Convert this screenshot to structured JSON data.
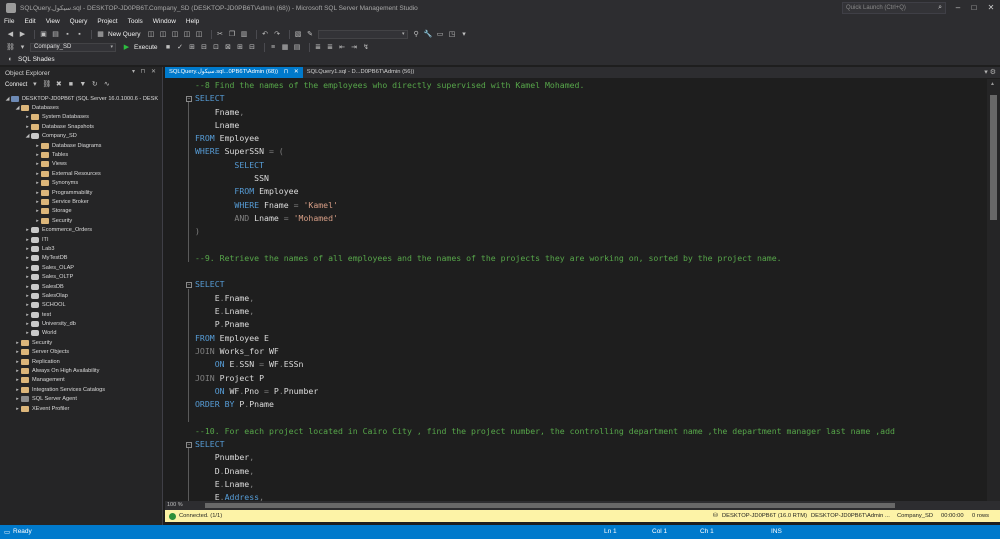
{
  "window": {
    "title": "SQLQuery.سيكول.sql - DESKTOP-JD0PB6T.Company_SD (DESKTOP-JD0PB6T\\Admin (68)) - Microsoft SQL Server Management Studio",
    "quick_launch_placeholder": "Quick Launch (Ctrl+Q)"
  },
  "menu": [
    "File",
    "Edit",
    "View",
    "Query",
    "Project",
    "Tools",
    "Window",
    "Help"
  ],
  "toolbar": {
    "new_query_label": "New Query",
    "database_selected": "Company_SD",
    "execute_label": "Execute",
    "sql_shades_label": "SQL Shades"
  },
  "object_explorer": {
    "title": "Object Explorer",
    "connect_label": "Connect",
    "nodes": [
      {
        "level": 0,
        "exp": "◢",
        "icon": "server",
        "label": "DESKTOP-JD0PB6T (SQL Server 16.0.1000.6 - DESK"
      },
      {
        "level": 1,
        "exp": "◢",
        "icon": "folder",
        "label": "Databases"
      },
      {
        "level": 2,
        "exp": "▸",
        "icon": "folder",
        "label": "System Databases"
      },
      {
        "level": 2,
        "exp": "▸",
        "icon": "folder",
        "label": "Database Snapshots"
      },
      {
        "level": 2,
        "exp": "◢",
        "icon": "db",
        "label": "Company_SD"
      },
      {
        "level": 3,
        "exp": "▸",
        "icon": "folder",
        "label": "Database Diagrams"
      },
      {
        "level": 3,
        "exp": "▸",
        "icon": "folder",
        "label": "Tables"
      },
      {
        "level": 3,
        "exp": "▸",
        "icon": "folder",
        "label": "Views"
      },
      {
        "level": 3,
        "exp": "▸",
        "icon": "folder",
        "label": "External Resources"
      },
      {
        "level": 3,
        "exp": "▸",
        "icon": "folder",
        "label": "Synonyms"
      },
      {
        "level": 3,
        "exp": "▸",
        "icon": "folder",
        "label": "Programmability"
      },
      {
        "level": 3,
        "exp": "▸",
        "icon": "folder",
        "label": "Service Broker"
      },
      {
        "level": 3,
        "exp": "▸",
        "icon": "folder",
        "label": "Storage"
      },
      {
        "level": 3,
        "exp": "▸",
        "icon": "folder",
        "label": "Security"
      },
      {
        "level": 2,
        "exp": "▸",
        "icon": "db",
        "label": "Ecommerce_Orders"
      },
      {
        "level": 2,
        "exp": "▸",
        "icon": "db",
        "label": "ITI"
      },
      {
        "level": 2,
        "exp": "▸",
        "icon": "db",
        "label": "Lab3"
      },
      {
        "level": 2,
        "exp": "▸",
        "icon": "db",
        "label": "MyTestDB"
      },
      {
        "level": 2,
        "exp": "▸",
        "icon": "db",
        "label": "Sales_OLAP"
      },
      {
        "level": 2,
        "exp": "▸",
        "icon": "db",
        "label": "Sales_OLTP"
      },
      {
        "level": 2,
        "exp": "▸",
        "icon": "db",
        "label": "SalesDB"
      },
      {
        "level": 2,
        "exp": "▸",
        "icon": "db",
        "label": "SalesOlap"
      },
      {
        "level": 2,
        "exp": "▸",
        "icon": "db",
        "label": "SCHOOL"
      },
      {
        "level": 2,
        "exp": "▸",
        "icon": "db",
        "label": "test"
      },
      {
        "level": 2,
        "exp": "▸",
        "icon": "db",
        "label": "University_db"
      },
      {
        "level": 2,
        "exp": "▸",
        "icon": "db",
        "label": "World"
      },
      {
        "level": 1,
        "exp": "▸",
        "icon": "folder",
        "label": "Security"
      },
      {
        "level": 1,
        "exp": "▸",
        "icon": "folder",
        "label": "Server Objects"
      },
      {
        "level": 1,
        "exp": "▸",
        "icon": "folder",
        "label": "Replication"
      },
      {
        "level": 1,
        "exp": "▸",
        "icon": "folder",
        "label": "Always On High Availability"
      },
      {
        "level": 1,
        "exp": "▸",
        "icon": "folder",
        "label": "Management"
      },
      {
        "level": 1,
        "exp": "▸",
        "icon": "folder",
        "label": "Integration Services Catalogs"
      },
      {
        "level": 1,
        "exp": "▸",
        "icon": "agent",
        "label": "SQL Server Agent"
      },
      {
        "level": 1,
        "exp": "▸",
        "icon": "folder",
        "label": "XEvent Profiler"
      }
    ]
  },
  "tabs": [
    {
      "label": "SQLQuery.سيكول.sql...0PB6T\\Admin (68))",
      "active": true
    },
    {
      "label": "SQLQuery1.sql - D...D0PB6T\\Admin (56))",
      "active": false
    }
  ],
  "code_lines": [
    [
      [
        "c",
        "--8 Find the names of the employees who directly supervised with Kamel Mohamed."
      ]
    ],
    [
      [
        "k",
        "SELECT"
      ]
    ],
    [
      [
        "t",
        "    Fname"
      ],
      [
        "p",
        ","
      ]
    ],
    [
      [
        "t",
        "    Lname"
      ]
    ],
    [
      [
        "k",
        "FROM"
      ],
      [
        "t",
        " Employee"
      ]
    ],
    [
      [
        "k",
        "WHERE"
      ],
      [
        "t",
        " SuperSSN "
      ],
      [
        "p",
        "= ("
      ]
    ],
    [
      [
        "k",
        "        SELECT"
      ]
    ],
    [
      [
        "t",
        "            SSN"
      ]
    ],
    [
      [
        "k",
        "        FROM"
      ],
      [
        "t",
        " Employee"
      ]
    ],
    [
      [
        "k",
        "        WHERE"
      ],
      [
        "t",
        " Fname "
      ],
      [
        "p",
        "= "
      ],
      [
        "s",
        "'Kamel'"
      ]
    ],
    [
      [
        "p",
        "        AND"
      ],
      [
        "t",
        " Lname "
      ],
      [
        "p",
        "= "
      ],
      [
        "s",
        "'Mohamed'"
      ]
    ],
    [
      [
        "p",
        ")"
      ]
    ],
    [
      [
        "t",
        ""
      ]
    ],
    [
      [
        "c",
        "--9. Retrieve the names of all employees and the names of the projects they are working on, sorted by the project name."
      ]
    ],
    [
      [
        "t",
        ""
      ]
    ],
    [
      [
        "k",
        "SELECT"
      ]
    ],
    [
      [
        "t",
        "    E"
      ],
      [
        "p",
        "."
      ],
      [
        "t",
        "Fname"
      ],
      [
        "p",
        ","
      ]
    ],
    [
      [
        "t",
        "    E"
      ],
      [
        "p",
        "."
      ],
      [
        "t",
        "Lname"
      ],
      [
        "p",
        ","
      ]
    ],
    [
      [
        "t",
        "    P"
      ],
      [
        "p",
        "."
      ],
      [
        "t",
        "Pname"
      ]
    ],
    [
      [
        "k",
        "FROM"
      ],
      [
        "t",
        " Employee E"
      ]
    ],
    [
      [
        "p",
        "JOIN"
      ],
      [
        "t",
        " Works_for WF"
      ]
    ],
    [
      [
        "k",
        "    ON"
      ],
      [
        "t",
        " E"
      ],
      [
        "p",
        "."
      ],
      [
        "t",
        "SSN "
      ],
      [
        "p",
        "="
      ],
      [
        "t",
        " WF"
      ],
      [
        "p",
        "."
      ],
      [
        "t",
        "ESSn"
      ]
    ],
    [
      [
        "p",
        "JOIN"
      ],
      [
        "t",
        " Project P"
      ]
    ],
    [
      [
        "k",
        "    ON"
      ],
      [
        "t",
        " WF"
      ],
      [
        "p",
        "."
      ],
      [
        "t",
        "Pno "
      ],
      [
        "p",
        "="
      ],
      [
        "t",
        " P"
      ],
      [
        "p",
        "."
      ],
      [
        "t",
        "Pnumber"
      ]
    ],
    [
      [
        "k",
        "ORDER BY"
      ],
      [
        "t",
        " P"
      ],
      [
        "p",
        "."
      ],
      [
        "t",
        "Pname"
      ]
    ],
    [
      [
        "t",
        ""
      ]
    ],
    [
      [
        "c",
        "--10. For each project located in Cairo City , find the project number, the controlling department name ,the department manager last name ,add"
      ]
    ],
    [
      [
        "k",
        "SELECT"
      ]
    ],
    [
      [
        "t",
        "    Pnumber"
      ],
      [
        "p",
        ","
      ]
    ],
    [
      [
        "t",
        "    D"
      ],
      [
        "p",
        "."
      ],
      [
        "t",
        "Dname"
      ],
      [
        "p",
        ","
      ]
    ],
    [
      [
        "t",
        "    E"
      ],
      [
        "p",
        "."
      ],
      [
        "t",
        "Lname"
      ],
      [
        "p",
        ","
      ]
    ],
    [
      [
        "t",
        "    E"
      ],
      [
        "p",
        "."
      ],
      [
        "k",
        "Address"
      ],
      [
        "p",
        ","
      ]
    ]
  ],
  "editor": {
    "zoom": "100 %",
    "collapse_lines": [
      1,
      15,
      27
    ]
  },
  "connection_bar": {
    "status": "Connected. (1/1)",
    "server": "DESKTOP-JD0PB6T (16.0 RTM)",
    "user": "DESKTOP-JD0PB6T\\Admin ...",
    "database": "Company_SD",
    "elapsed": "00:00:00",
    "rows": "0 rows"
  },
  "status_bar": {
    "ready": "Ready",
    "ln": "Ln 1",
    "col": "Col 1",
    "ch": "Ch 1",
    "ins": "INS"
  }
}
